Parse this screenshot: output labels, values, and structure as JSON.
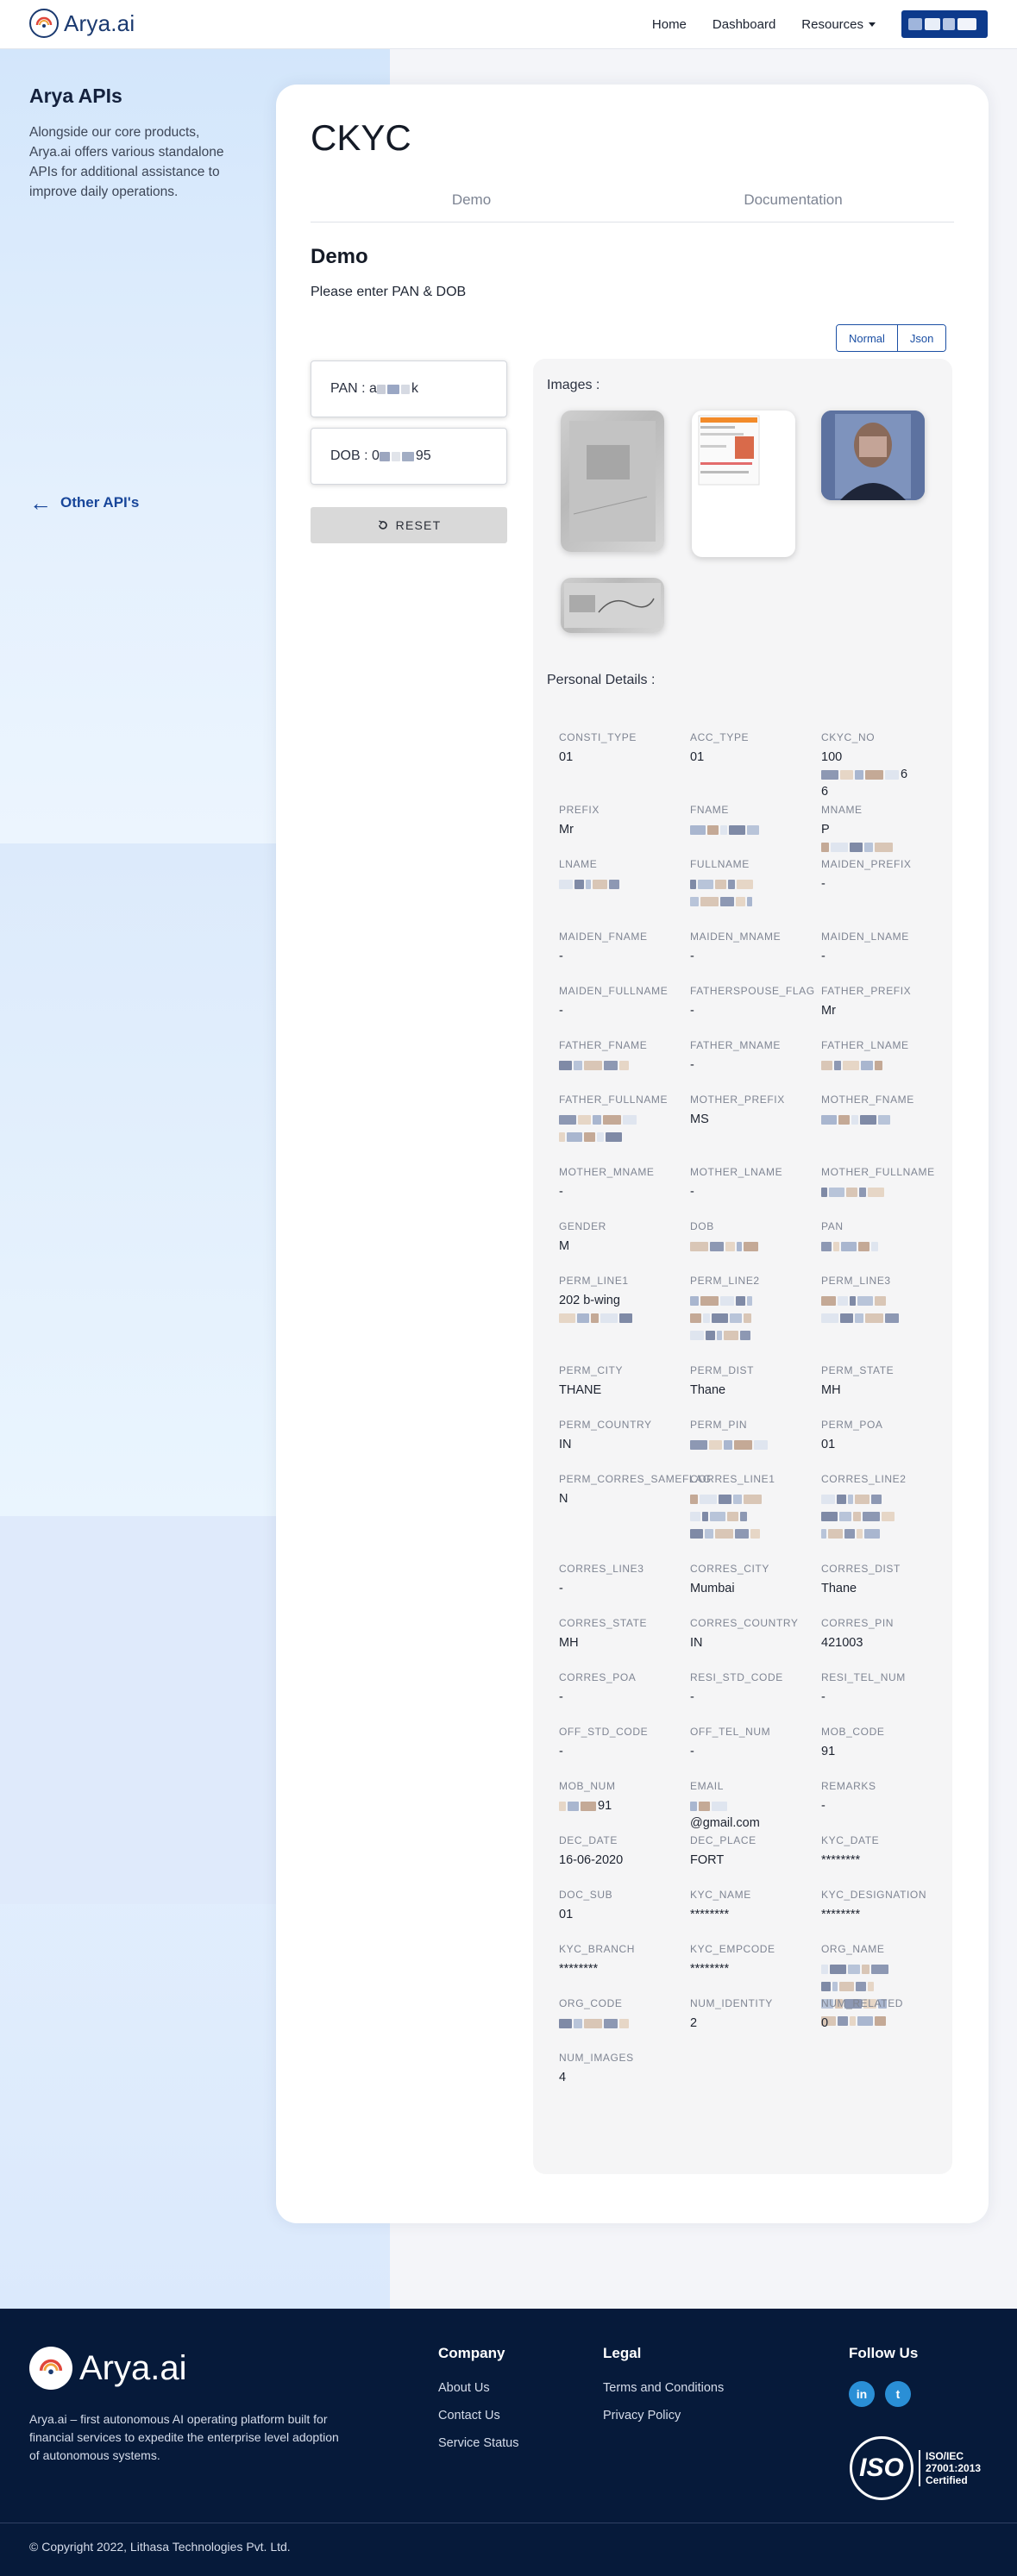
{
  "nav": {
    "logo_text": "Arya.ai",
    "links": [
      "Home",
      "Dashboard",
      "Resources"
    ]
  },
  "sidebar": {
    "title": "Arya APIs",
    "description": "Alongside our core products, Arya.ai offers various standalone APIs for additional assistance to improve daily operations.",
    "other_apis": "Other API's"
  },
  "main": {
    "title": "CKYC",
    "tabs": [
      "Demo",
      "Documentation"
    ],
    "section_title": "Demo",
    "instruction": "Please enter PAN & DOB",
    "view_toggle": [
      "Normal",
      "Json"
    ],
    "pan_field": "PAN : a",
    "pan_suffix": "k",
    "dob_field": "DOB : 0",
    "dob_suffix": "95",
    "reset_label": "RESET"
  },
  "results": {
    "images_heading": "Images :",
    "personal_heading": "Personal Details :",
    "fields": [
      {
        "label": "CONSTI_TYPE",
        "value": "01"
      },
      {
        "label": "ACC_TYPE",
        "value": "01"
      },
      {
        "label": "CKYC_NO",
        "value": "100",
        "tail": "6",
        "tail2": "6"
      },
      {
        "label": "PREFIX",
        "value": "Mr"
      },
      {
        "label": "FNAME",
        "value": ""
      },
      {
        "label": "MNAME",
        "value": "P"
      },
      {
        "label": "LNAME",
        "value": ""
      },
      {
        "label": "FULLNAME",
        "value": ""
      },
      {
        "label": "MAIDEN_PREFIX",
        "value": "-"
      },
      {
        "label": "MAIDEN_FNAME",
        "value": "-"
      },
      {
        "label": "MAIDEN_MNAME",
        "value": "-"
      },
      {
        "label": "MAIDEN_LNAME",
        "value": "-"
      },
      {
        "label": "MAIDEN_FULLNAME",
        "value": "-"
      },
      {
        "label": "FATHERSPOUSE_FLAG",
        "value": "-"
      },
      {
        "label": "FATHER_PREFIX",
        "value": "Mr"
      },
      {
        "label": "FATHER_FNAME",
        "value": ""
      },
      {
        "label": "FATHER_MNAME",
        "value": "-"
      },
      {
        "label": "FATHER_LNAME",
        "value": ""
      },
      {
        "label": "FATHER_FULLNAME",
        "value": ""
      },
      {
        "label": "MOTHER_PREFIX",
        "value": "MS"
      },
      {
        "label": "MOTHER_FNAME",
        "value": ""
      },
      {
        "label": "MOTHER_MNAME",
        "value": "-"
      },
      {
        "label": "MOTHER_LNAME",
        "value": "-"
      },
      {
        "label": "MOTHER_FULLNAME",
        "value": ""
      },
      {
        "label": "GENDER",
        "value": "M"
      },
      {
        "label": "DOB",
        "value": ""
      },
      {
        "label": "PAN",
        "value": ""
      },
      {
        "label": "PERM_LINE1",
        "value": "202 b-wing"
      },
      {
        "label": "PERM_LINE2",
        "value": ""
      },
      {
        "label": "PERM_LINE3",
        "value": ""
      },
      {
        "label": "PERM_CITY",
        "value": "THANE"
      },
      {
        "label": "PERM_DIST",
        "value": "Thane"
      },
      {
        "label": "PERM_STATE",
        "value": "MH"
      },
      {
        "label": "PERM_COUNTRY",
        "value": "IN"
      },
      {
        "label": "PERM_PIN",
        "value": ""
      },
      {
        "label": "PERM_POA",
        "value": "01"
      },
      {
        "label": "PERM_CORRES_SAMEFLAG",
        "value": "N"
      },
      {
        "label": "CORRES_LINE1",
        "value": ""
      },
      {
        "label": "CORRES_LINE2",
        "value": ""
      },
      {
        "label": "CORRES_LINE3",
        "value": "-"
      },
      {
        "label": "CORRES_CITY",
        "value": "Mumbai"
      },
      {
        "label": "CORRES_DIST",
        "value": "Thane"
      },
      {
        "label": "CORRES_STATE",
        "value": "MH"
      },
      {
        "label": "CORRES_COUNTRY",
        "value": "IN"
      },
      {
        "label": "CORRES_PIN",
        "value": "421003"
      },
      {
        "label": "CORRES_POA",
        "value": "-"
      },
      {
        "label": "RESI_STD_CODE",
        "value": "-"
      },
      {
        "label": "RESI_TEL_NUM",
        "value": "-"
      },
      {
        "label": "OFF_STD_CODE",
        "value": "-"
      },
      {
        "label": "OFF_TEL_NUM",
        "value": "-"
      },
      {
        "label": "MOB_CODE",
        "value": "91"
      },
      {
        "label": "MOB_NUM",
        "value": "91"
      },
      {
        "label": "EMAIL",
        "value": "@gmail.com"
      },
      {
        "label": "REMARKS",
        "value": "-"
      },
      {
        "label": "DEC_DATE",
        "value": "16-06-2020"
      },
      {
        "label": "DEC_PLACE",
        "value": "FORT"
      },
      {
        "label": "KYC_DATE",
        "value": "********"
      },
      {
        "label": "DOC_SUB",
        "value": "01"
      },
      {
        "label": "KYC_NAME",
        "value": "********"
      },
      {
        "label": "KYC_DESIGNATION",
        "value": "********"
      },
      {
        "label": "KYC_BRANCH",
        "value": "********"
      },
      {
        "label": "KYC_EMPCODE",
        "value": "********"
      },
      {
        "label": "ORG_NAME",
        "value": ""
      },
      {
        "label": "ORG_CODE",
        "value": ""
      },
      {
        "label": "NUM_IDENTITY",
        "value": "2"
      },
      {
        "label": "NUM_RELATED",
        "value": "0"
      },
      {
        "label": "NUM_IMAGES",
        "value": "4"
      }
    ]
  },
  "footer": {
    "logo_text": "Arya.ai",
    "description": "Arya.ai – first autonomous AI operating platform built for financial services to expedite the enterprise level adoption of autonomous systems.",
    "company_heading": "Company",
    "company_links": [
      "About Us",
      "Contact Us",
      "Service Status"
    ],
    "legal_heading": "Legal",
    "legal_links": [
      "Terms and Conditions",
      "Privacy Policy"
    ],
    "follow_heading": "Follow Us",
    "social": [
      "in",
      "t"
    ],
    "iso_mark": "ISO",
    "iso_lines": [
      "ISO/IEC",
      "27001:2013",
      "Certified"
    ],
    "copyright": "© Copyright 2022, Lithasa Technologies Pvt. Ltd."
  },
  "colors": {
    "brand_navy": "#061a3a",
    "brand_blue": "#0d3a8c",
    "link_blue": "#18469a"
  }
}
